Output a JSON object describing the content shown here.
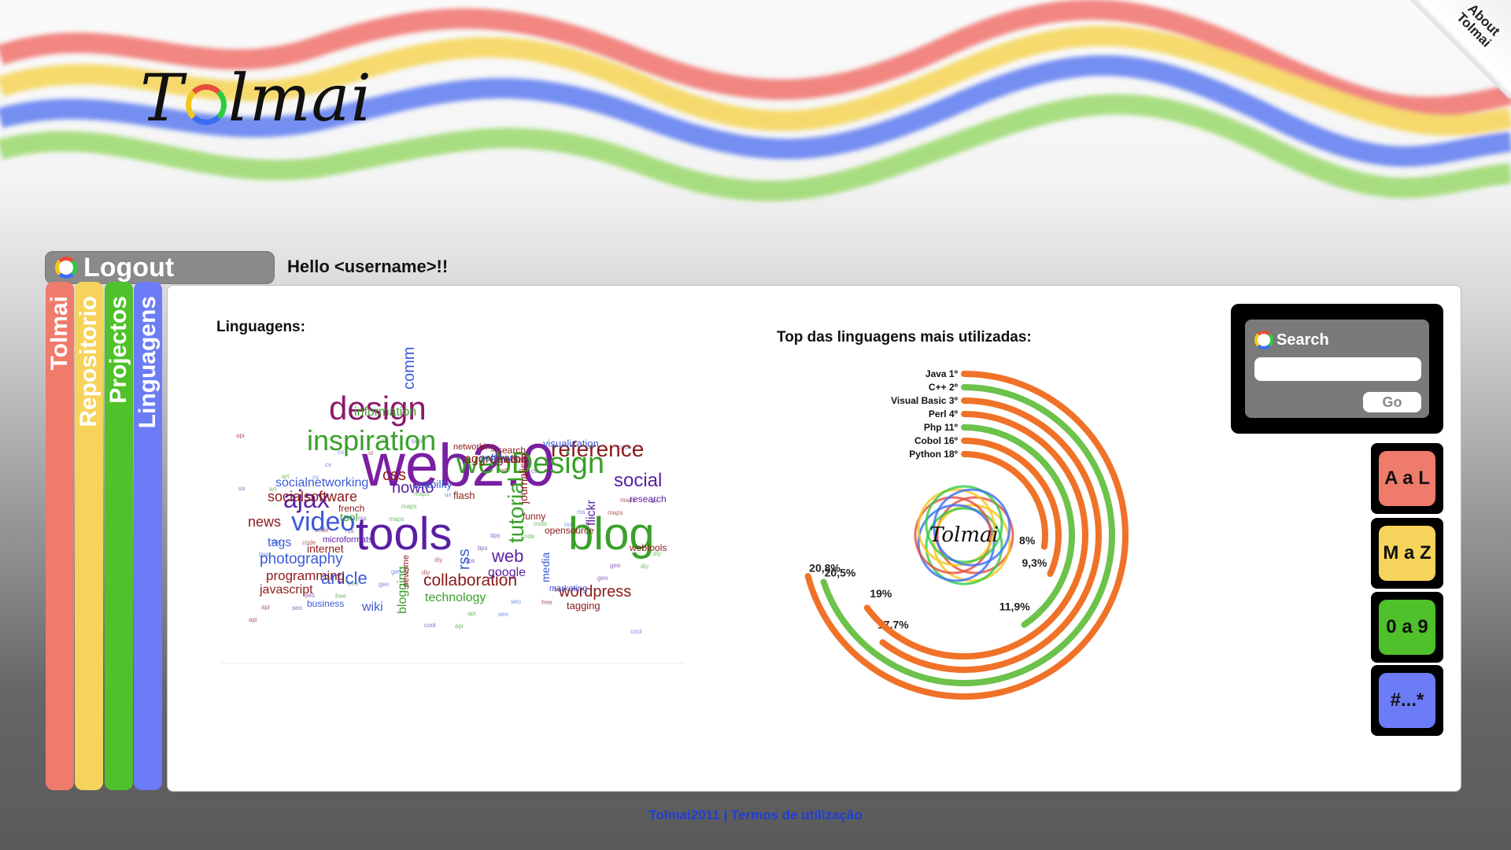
{
  "header": {
    "logo_pre": "T",
    "logo_post": "lmai",
    "about_line1": "About",
    "about_line2": "Tolmai"
  },
  "user": {
    "logout_label": "Logout",
    "greeting": "Hello <username>!!"
  },
  "nav_tabs": [
    {
      "label": "Tolmai",
      "color": "#ef7b6b"
    },
    {
      "label": "Repositorio",
      "color": "#f6d35a"
    },
    {
      "label": "Projectos",
      "color": "#4fc12a"
    },
    {
      "label": "Linguagens",
      "color": "#6c7cf6"
    }
  ],
  "main": {
    "cloud_title": "Linguagens:",
    "chart_title": "Top das linguagens mais utilizadas:"
  },
  "tag_cloud": [
    {
      "t": "web2.0",
      "c": "#7a1fa2"
    },
    {
      "t": "tools",
      "c": "#5a1fa2"
    },
    {
      "t": "blog",
      "c": "#3aa02a"
    },
    {
      "t": "webDesign",
      "c": "#3aa02a"
    },
    {
      "t": "design",
      "c": "#8b1a6b"
    },
    {
      "t": "inspiration",
      "c": "#3aa02a"
    },
    {
      "t": "reference",
      "c": "#8b1a1a"
    },
    {
      "t": "ajax",
      "c": "#5a1fa2"
    },
    {
      "t": "video",
      "c": "#3b5bd8"
    },
    {
      "t": "social",
      "c": "#5a1fa2"
    },
    {
      "t": "tutorial",
      "c": "#3aa02a"
    },
    {
      "t": "photography",
      "c": "#3b5bd8"
    },
    {
      "t": "article",
      "c": "#3b5bd8"
    },
    {
      "t": "collaboration",
      "c": "#8b1a1a"
    },
    {
      "t": "wordpress",
      "c": "#8b1a1a"
    },
    {
      "t": "programming",
      "c": "#8b1a1a"
    },
    {
      "t": "javascript",
      "c": "#8b1a1a"
    },
    {
      "t": "technology",
      "c": "#3aa02a"
    },
    {
      "t": "community",
      "c": "#3b5bd8"
    },
    {
      "t": "information",
      "c": "#3aa02a"
    },
    {
      "t": "socialsoftware",
      "c": "#8b1a1a"
    },
    {
      "t": "socialnetworking",
      "c": "#3b5bd8"
    },
    {
      "t": "howto",
      "c": "#5a1fa2"
    },
    {
      "t": "css",
      "c": "#8b1a1a"
    },
    {
      "t": "aggregator",
      "c": "#8b1a1a"
    },
    {
      "t": "news",
      "c": "#8b1a1a"
    },
    {
      "t": "tags",
      "c": "#3b5bd8"
    },
    {
      "t": "google",
      "c": "#5a1fa2"
    },
    {
      "t": "web",
      "c": "#5a1fa2"
    },
    {
      "t": "rss",
      "c": "#3b5bd8"
    },
    {
      "t": "blogging",
      "c": "#3aa02a"
    },
    {
      "t": "internet",
      "c": "#8b1a1a"
    },
    {
      "t": "flickr",
      "c": "#5a1fa2"
    },
    {
      "t": "tagging",
      "c": "#8b1a1a"
    },
    {
      "t": "software",
      "c": "#3b5bd8"
    },
    {
      "t": "visualization",
      "c": "#3b5bd8"
    },
    {
      "t": "research",
      "c": "#5a1fa2"
    },
    {
      "t": "flash",
      "c": "#8b1a1a"
    },
    {
      "t": "opensource",
      "c": "#8b1a1a"
    },
    {
      "t": "wiki",
      "c": "#3b5bd8"
    },
    {
      "t": "business",
      "c": "#3b5bd8"
    },
    {
      "t": "usability",
      "c": "#3b5bd8"
    },
    {
      "t": "media",
      "c": "#3b5bd8"
    },
    {
      "t": "journalism",
      "c": "#8b1a1a"
    },
    {
      "t": "webtools",
      "c": "#8b1a1a"
    },
    {
      "t": "marketing",
      "c": "#3b5bd8"
    },
    {
      "t": "search",
      "c": "#8b1a1a"
    },
    {
      "t": "tool",
      "c": "#3aa02a"
    },
    {
      "t": "french",
      "c": "#8b1a1a"
    },
    {
      "t": "funny",
      "c": "#8b1a1a"
    },
    {
      "t": "networking",
      "c": "#8b1a1a"
    },
    {
      "t": "medias",
      "c": "#8b1a1a"
    },
    {
      "t": "newsme",
      "c": "#8b1a1a"
    },
    {
      "t": "microformats",
      "c": "#5a1fa2"
    }
  ],
  "chart_data": {
    "type": "radial_bar",
    "title": "Top das linguagens mais utilizadas:",
    "categories": [
      "Java",
      "C++",
      "Visual Basic",
      "Perl",
      "Php",
      "Cobol",
      "Python"
    ],
    "ranks": [
      "1º",
      "2º",
      "3º",
      "4º",
      "11º",
      "16º",
      "18º"
    ],
    "values": [
      20.8,
      20.5,
      17.7,
      19,
      11.9,
      9.3,
      8
    ],
    "value_labels": [
      "20,8%",
      "20,5%",
      "17,7%",
      "19%",
      "11,9%",
      "9,3%",
      "8%"
    ],
    "colors": [
      "#f07228",
      "#6cc24a",
      "#f07228",
      "#f07228",
      "#6cc24a",
      "#f07228",
      "#f07228"
    ],
    "vmax": 22,
    "center_logo": "Tolmai"
  },
  "search": {
    "label": "Search",
    "value": "",
    "placeholder": "",
    "go_label": "Go"
  },
  "filters": [
    {
      "label": "A a L",
      "color": "#ef7b6b"
    },
    {
      "label": "M a Z",
      "color": "#f6d35a"
    },
    {
      "label": "0 a 9",
      "color": "#4fc12a"
    },
    {
      "label": "#...*",
      "color": "#6c7cf6"
    }
  ],
  "footer": {
    "copyright": "Tolmai2011",
    "separator": " | ",
    "terms": "Termos de utilização"
  }
}
